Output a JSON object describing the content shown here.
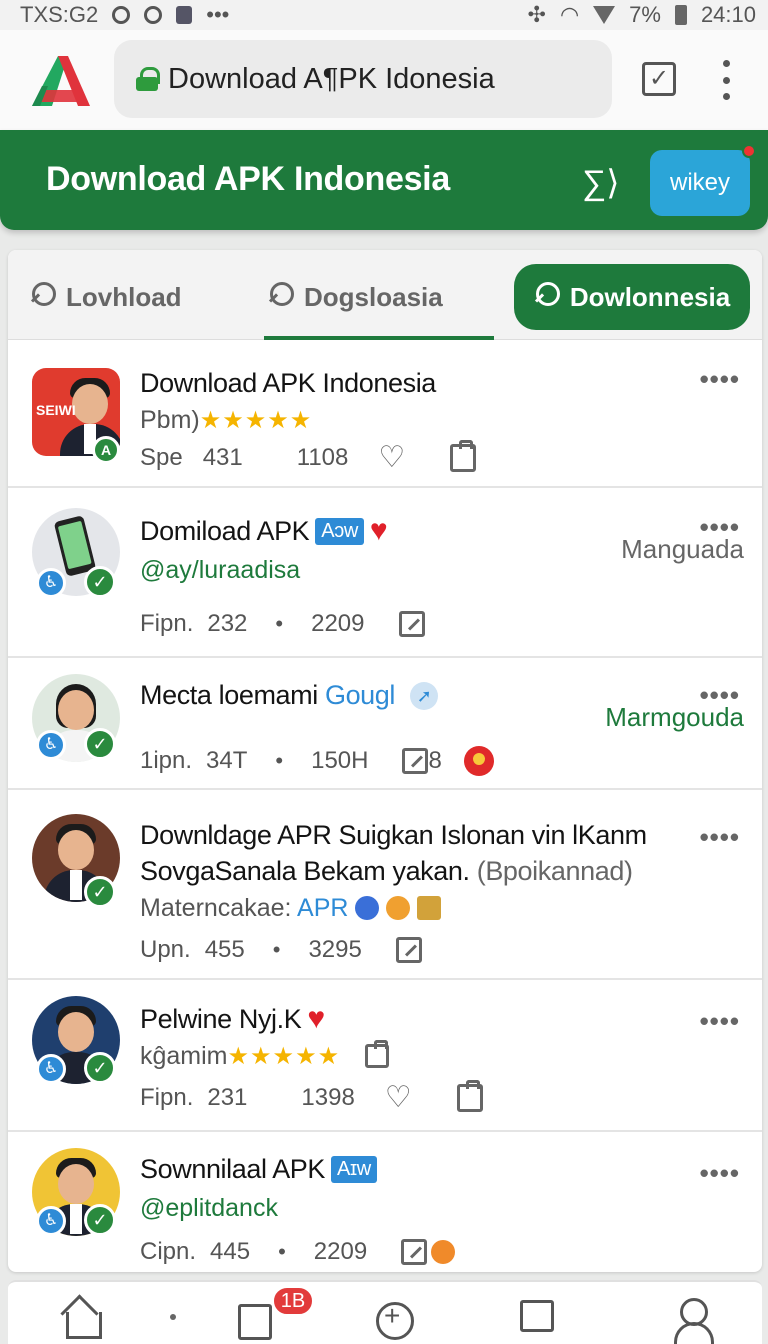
{
  "status_bar": {
    "left_text": "TXS:G2",
    "battery": "7%",
    "time": "24:10"
  },
  "browser": {
    "url_text": "Download A¶PK Idonesia"
  },
  "header": {
    "title": "Download APK Indonesia",
    "action_label": "wikey"
  },
  "tabs": [
    {
      "label": "Lovhload"
    },
    {
      "label": "Dogsloasia"
    },
    {
      "label": "Dowlonnesia"
    }
  ],
  "feed": [
    {
      "title": "Download APK Indonesia",
      "subtitle": "Pbm)",
      "rating": "★★★★★",
      "avatar_label": "SEIWI",
      "stat_prefix": "Spe",
      "stat_a": "431",
      "stat_b": "1108",
      "more": "••••"
    },
    {
      "title": "Domiload APK",
      "chip": "Aɔw",
      "heart": "♥",
      "handle": "@ay/luraadisa",
      "side_label": "Manguada",
      "stat_prefix": "Fipn.",
      "stat_a": "232",
      "stat_b": "2209",
      "more": "••••"
    },
    {
      "title_plain": "Mecta loemami",
      "title_blue": "Gougl",
      "side_label": "Marmgouda",
      "stat_prefix": "1ipn.",
      "stat_a": "34T",
      "stat_b": "150H",
      "stat_c": "8",
      "more": "••••"
    },
    {
      "title_line1": "Downldage APR Suigkan Islonan vin lKanm",
      "title_line2_plain": "SovgaSanala Bekam yakan.",
      "title_line2_gray": "(Bpoikannad)",
      "sub_plain": "Materncakae:",
      "sub_blue": "APR",
      "stat_prefix": "Upn.",
      "stat_a": "455",
      "stat_b": "3295",
      "more": "••••"
    },
    {
      "title": "Pelwine Nyj.K",
      "heart": "♥",
      "subtitle": "kĝamim",
      "rating": "★★★★★",
      "stat_prefix": "Fipn.",
      "stat_a": "231",
      "stat_b": "1398",
      "more": "••••"
    },
    {
      "title": "Sownnilaal APK",
      "chip": "Aɪw",
      "handle": "@eplitdanck",
      "stat_prefix": "Cipn.",
      "stat_a": "445",
      "stat_b": "2209",
      "more": "••••"
    }
  ],
  "bottom_nav": {
    "badge": "1B"
  },
  "colors": {
    "primary_green": "#1e7a3c",
    "accent_blue": "#2ba5d8",
    "heart_red": "#e0202a",
    "star_gold": "#f5b400"
  }
}
